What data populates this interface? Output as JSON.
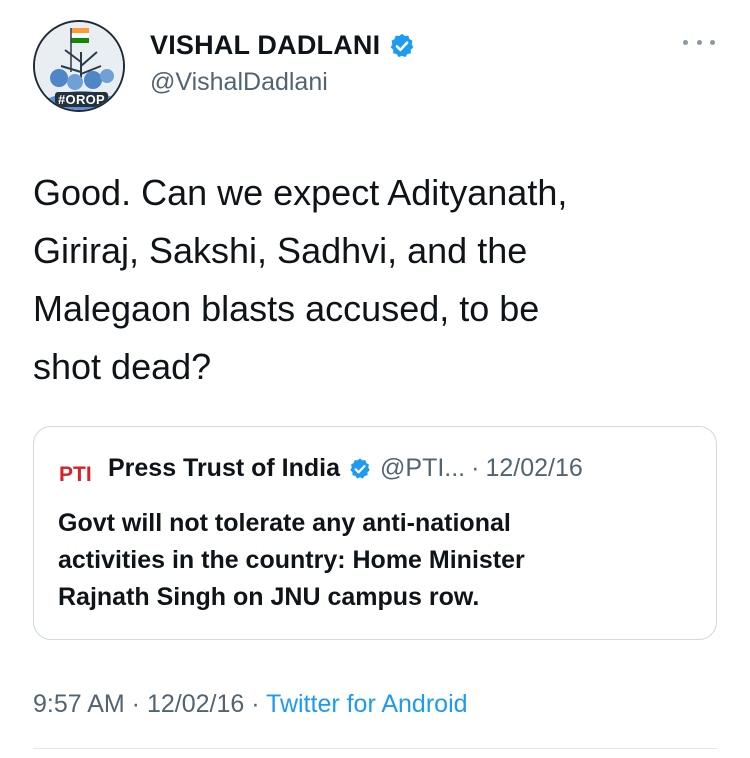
{
  "author": {
    "name": "VISHAL DADLANI",
    "handle": "@VishalDadlani",
    "avatar_badge": "#OROP",
    "verified_icon": "verified-badge-icon"
  },
  "tweet": {
    "lines": [
      "Good. Can we expect Adityanath,",
      "Giriraj, Sakshi, Sadhvi, and the",
      "Malegaon blasts accused, to be",
      "shot dead?"
    ]
  },
  "quote": {
    "logo_text": "PTI",
    "name": "Press Trust of India",
    "handle": "@PTI...",
    "separator": "·",
    "date": "12/02/16",
    "lines": [
      "Govt will not tolerate any anti-national",
      "activities in the country: Home Minister",
      "Rajnath Singh on JNU campus row."
    ]
  },
  "meta": {
    "time": "9:57 AM",
    "sep1": " · ",
    "date": "12/02/16",
    "sep2": " · ",
    "source": "Twitter for Android"
  },
  "colors": {
    "verified": "#1d9bf0",
    "secondary_text": "#536471",
    "link": "#1d9bf0",
    "pti_red": "#d6232a"
  }
}
